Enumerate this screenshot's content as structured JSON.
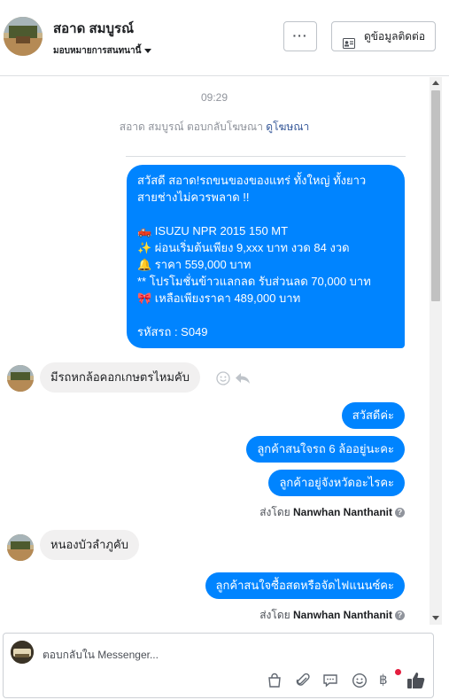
{
  "header": {
    "contact_name": "สอาด สมบูรณ์",
    "assign_label": "มอบหมายการสนทนานี้",
    "more_label": "···",
    "contact_info_label": "ดูข้อมูลติดต่อ"
  },
  "thread": {
    "timestamp": "09:29",
    "reply_note_prefix": "สอาด สมบูรณ์ ตอบกลับโฆษณา",
    "reply_note_link": "ดูโฆษณา",
    "ad_message": {
      "lines": [
        "สวัสดี สอาด!รถขนของของแทร่ ทั้งใหญ่ ทั้งยาว",
        "สายช่างไม่ควรพลาด !!",
        "",
        "🛻  ISUZU NPR 2015 150 MT",
        "✨  ผ่อนเริ่มต้นเพียง 9,xxx บาท งวด 84 งวด",
        "🔔 ราคา 559,000 บาท",
        "** โปรโมชั่นข้าวแลกลด รับส่วนลด 70,000 บาท",
        "🎀  เหลือเพียงราคา 489,000 บาท",
        "",
        " รหัสรถ : S049"
      ]
    },
    "messages": [
      {
        "direction": "in",
        "text": "มีรถหกล้อคอกเกษตรไหมคับ"
      },
      {
        "direction": "out",
        "text": "สวัสดีค่ะ"
      },
      {
        "direction": "out",
        "text": "ลูกค้าสนใจรถ 6 ล้ออยู่นะคะ"
      },
      {
        "direction": "out",
        "text": "ลูกค้าอยู่จังหวัดอะไรคะ"
      },
      {
        "direction": "in",
        "text": "หนองบัวลำภูคับ"
      },
      {
        "direction": "out",
        "text": "ลูกค้าสนใจซื้อสดหรือจัดไฟแนนซ์คะ"
      }
    ],
    "sent_by_prefix": "ส่งโดย",
    "sent_by_name": "Nanwhan Nanthanit",
    "help_glyph": "?"
  },
  "composer": {
    "placeholder": "ตอบกลับใน Messenger...",
    "tools": [
      "shopping-bag-icon",
      "paperclip-icon",
      "message-icon",
      "emoji-icon",
      "baht-icon",
      "thumbs-up-icon"
    ],
    "baht_glyph": "฿"
  },
  "colors": {
    "outgoing_bubble": "#0084ff",
    "incoming_bubble": "#f1f0f0",
    "link": "#365899",
    "notification_dot": "#e41e3f"
  }
}
